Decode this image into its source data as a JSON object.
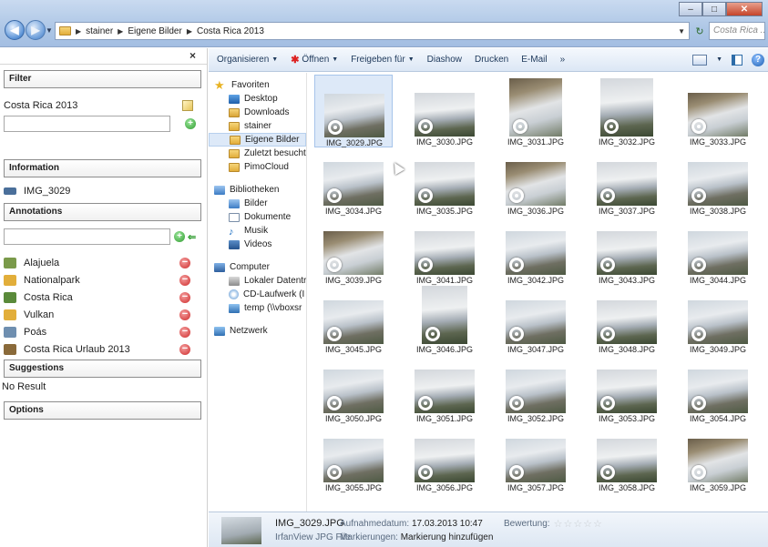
{
  "window": {
    "controls": [
      "–",
      "□",
      "✕"
    ],
    "breadcrumb": [
      "stainer",
      "Eigene Bilder",
      "Costa Rica 2013"
    ],
    "search_placeholder": "Costa Rica ..."
  },
  "toolbar": {
    "organize": "Organisieren",
    "open": "Öffnen",
    "share": "Freigeben für",
    "slideshow": "Diashow",
    "print": "Drucken",
    "email": "E-Mail",
    "more": "»"
  },
  "filter_panel": {
    "close_label": "×",
    "filter_head": "Filter",
    "filter_value": "Costa Rica 2013",
    "information_head": "Information",
    "info_file": "IMG_3029",
    "annotations_head": "Annotations",
    "annotations": [
      {
        "label": "Alajuela",
        "icon": "map-icon",
        "color": "#7a9a4a"
      },
      {
        "label": "Nationalpark",
        "icon": "folder-icon",
        "color": "#e2ae3a"
      },
      {
        "label": "Costa Rica",
        "icon": "globe-icon",
        "color": "#5a8a3a"
      },
      {
        "label": "Vulkan",
        "icon": "folder-icon",
        "color": "#e2ae3a"
      },
      {
        "label": "Poás",
        "icon": "picture-icon",
        "color": "#6f8fb0"
      },
      {
        "label": "Costa Rica Urlaub 2013",
        "icon": "album-icon",
        "color": "#8a6a3a"
      }
    ],
    "suggestions_head": "Suggestions",
    "suggestions_result": "No Result",
    "options_head": "Options"
  },
  "navigation": {
    "favorites_head": "Favoriten",
    "favorites": [
      "Desktop",
      "Downloads",
      "stainer",
      "Eigene Bilder",
      "Zuletzt besucht",
      "PimoCloud"
    ],
    "selected_favorite": "Eigene Bilder",
    "libraries_head": "Bibliotheken",
    "libraries": [
      "Bilder",
      "Dokumente",
      "Musik",
      "Videos"
    ],
    "computer_head": "Computer",
    "computer": [
      "Lokaler Datentr",
      "CD-Laufwerk (I",
      "temp (\\\\vboxsr"
    ],
    "network_head": "Netzwerk"
  },
  "files": [
    "IMG_3029.JPG",
    "IMG_3030.JPG",
    "IMG_3031.JPG",
    "IMG_3032.JPG",
    "IMG_3033.JPG",
    "IMG_3034.JPG",
    "IMG_3035.JPG",
    "IMG_3036.JPG",
    "IMG_3037.JPG",
    "IMG_3038.JPG",
    "IMG_3039.JPG",
    "IMG_3041.JPG",
    "IMG_3042.JPG",
    "IMG_3043.JPG",
    "IMG_3044.JPG",
    "IMG_3045.JPG",
    "IMG_3046.JPG",
    "IMG_3047.JPG",
    "IMG_3048.JPG",
    "IMG_3049.JPG",
    "IMG_3050.JPG",
    "IMG_3051.JPG",
    "IMG_3052.JPG",
    "IMG_3053.JPG",
    "IMG_3054.JPG",
    "IMG_3055.JPG",
    "IMG_3056.JPG",
    "IMG_3057.JPG",
    "IMG_3058.JPG",
    "IMG_3059.JPG"
  ],
  "selected_file": "IMG_3029.JPG",
  "details": {
    "name": "IMG_3029.JPG",
    "type": "IrfanView JPG File",
    "date_label": "Aufnahmedatum:",
    "date_value": "17.03.2013 10:47",
    "tags_label": "Markierungen:",
    "tags_value": "Markierung hinzufügen",
    "rating_label": "Bewertung:",
    "rating_stars": "☆☆☆☆☆"
  }
}
